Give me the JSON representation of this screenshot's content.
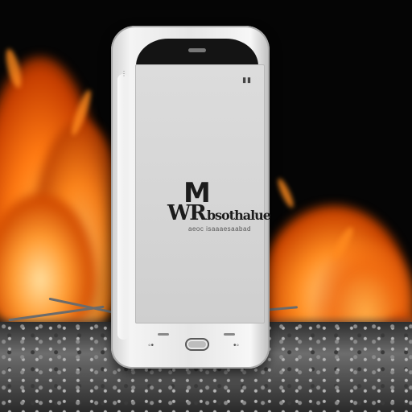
{
  "scene": {
    "description_colors": {
      "background": "#050505",
      "fire_core": "#ffb347",
      "fire_mid": "#ff7a12",
      "ash": "#6d6d6d",
      "phone_body": "#f4f4f4"
    }
  },
  "phone": {
    "status_icon": "▮▮",
    "side_dots": "⋮",
    "logo_big": "M",
    "logo_wr": "WR",
    "logo_word": "bsothalue",
    "logo_sub": "aeoc isaaaesaabad",
    "left_key_icon": "◦•",
    "right_key_icon": "•◦",
    "icons": {
      "home": "home-button-icon",
      "signal": "signal-icon"
    }
  }
}
